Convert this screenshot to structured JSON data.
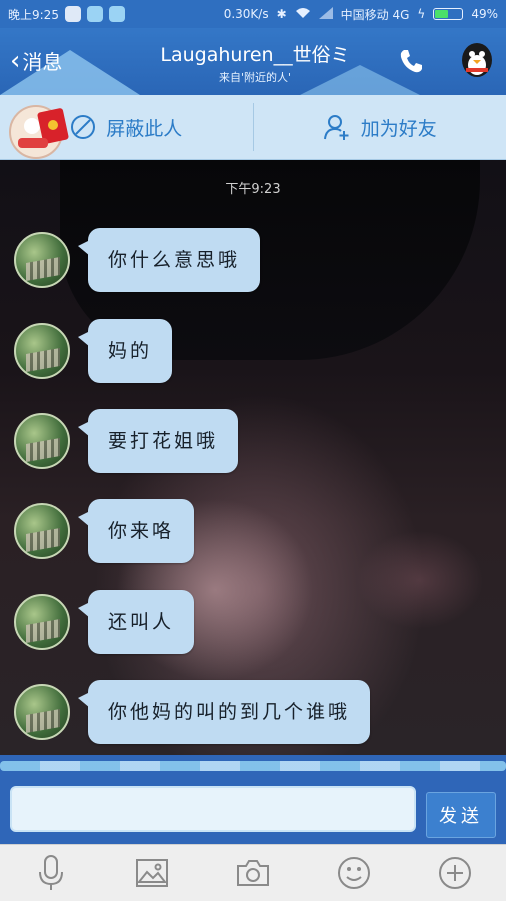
{
  "status_bar": {
    "time": "晚上9:25",
    "network_speed": "0.30K/s",
    "carrier": "中国移动 4G",
    "battery_percent": "49%",
    "battery_level": 0.49
  },
  "header": {
    "back_label": "消息",
    "title": "Laugahuren__世俗ミ",
    "subtitle": "来自'附近的人'"
  },
  "actions": {
    "block_label": "屏蔽此人",
    "add_friend_label": "加为好友"
  },
  "chat": {
    "timestamp": "下午9:23",
    "messages": [
      {
        "text": "你什么意思哦"
      },
      {
        "text": "妈的"
      },
      {
        "text": "要打花姐哦"
      },
      {
        "text": "你来咯"
      },
      {
        "text": "还叫人"
      },
      {
        "text": "你他妈的叫的到几个谁哦"
      }
    ]
  },
  "input": {
    "value": "",
    "send_label": "发送"
  },
  "toolbar": {
    "items": [
      "microphone-icon",
      "image-icon",
      "camera-icon",
      "emoji-icon",
      "plus-icon"
    ]
  },
  "colors": {
    "header_blue": "#2f6fc0",
    "bubble": "#bfdbf2",
    "action_text": "#2c7cc7"
  }
}
